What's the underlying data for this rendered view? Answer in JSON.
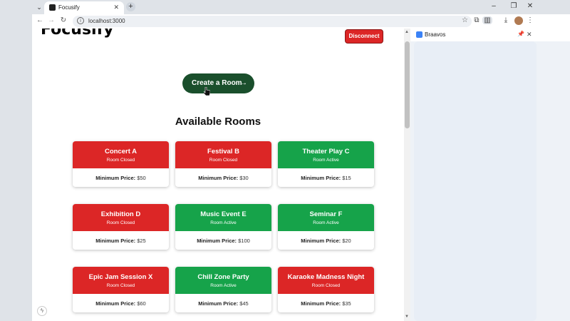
{
  "browser": {
    "tab_title": "Focusify",
    "url": "localhost:3000",
    "side_panel_title": "Braavos"
  },
  "page": {
    "logo": "Focusify",
    "disconnect_label": "Disconnect",
    "create_room_label": "Create a Room",
    "section_title": "Available Rooms",
    "price_label": "Minimum Price:",
    "rooms": [
      {
        "name": "Concert A",
        "status": "Room Closed",
        "state": "closed",
        "price": "$50"
      },
      {
        "name": "Festival B",
        "status": "Room Closed",
        "state": "closed",
        "price": "$30"
      },
      {
        "name": "Theater Play C",
        "status": "Room Active",
        "state": "active",
        "price": "$15"
      },
      {
        "name": "Exhibition D",
        "status": "Room Closed",
        "state": "closed",
        "price": "$25"
      },
      {
        "name": "Music Event E",
        "status": "Room Active",
        "state": "active",
        "price": "$100"
      },
      {
        "name": "Seminar F",
        "status": "Room Active",
        "state": "active",
        "price": "$20"
      },
      {
        "name": "Epic Jam Session X",
        "status": "Room Closed",
        "state": "closed",
        "price": "$60"
      },
      {
        "name": "Chill Zone Party",
        "status": "Room Active",
        "state": "active",
        "price": "$45"
      },
      {
        "name": "Karaoke Madness Night",
        "status": "Room Closed",
        "state": "closed",
        "price": "$35"
      }
    ]
  },
  "colors": {
    "closed": "#dc2626",
    "active": "#16a34a",
    "create_button": "#1a4f2c"
  }
}
